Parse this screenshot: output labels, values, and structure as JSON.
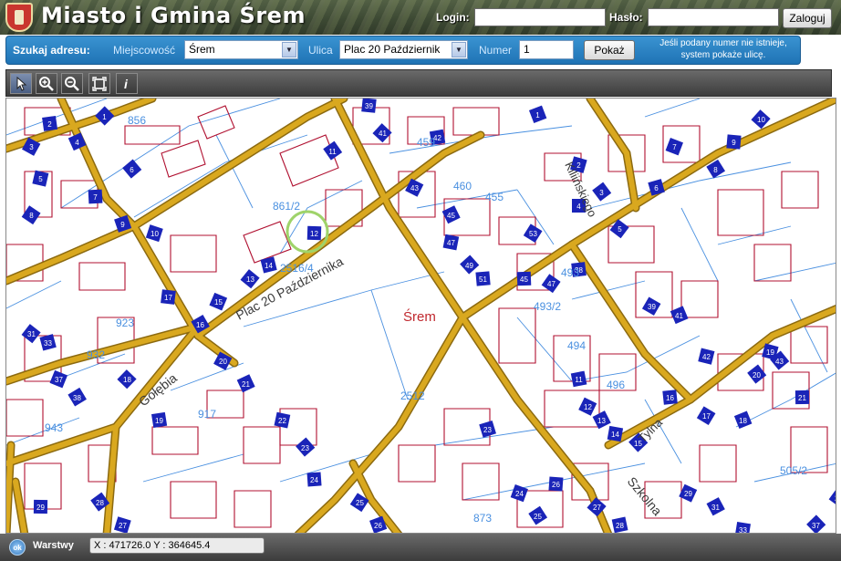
{
  "header": {
    "title": "Miasto i Gmina Śrem",
    "login_label": "Login:",
    "login_value": "",
    "password_label": "Hasło:",
    "password_value": "",
    "login_button": "Zaloguj"
  },
  "search": {
    "label": "Szukaj adresu:",
    "city_label": "Miejscowość",
    "city_value": "Śrem",
    "street_label": "Ulica",
    "street_value": "Plac 20 Październik",
    "number_label": "Numer",
    "number_value": "1",
    "show_button": "Pokaż",
    "hint_line1": "Jeśli podany numer nie istnieje,",
    "hint_line2": "system pokaże ulicę."
  },
  "toolbar": {
    "tools": [
      {
        "name": "pointer-icon",
        "active": true
      },
      {
        "name": "zoom-in-icon",
        "active": false
      },
      {
        "name": "zoom-out-icon",
        "active": false
      },
      {
        "name": "full-extent-icon",
        "active": false
      },
      {
        "name": "info-icon",
        "active": false
      }
    ]
  },
  "map": {
    "colors": {
      "road": "#d9a81f",
      "road_edge": "#8c6a10",
      "parcel": "#4a90e0",
      "building": "#b01030",
      "badge": "#1a24b8"
    },
    "town_label": "Śrem",
    "street_labels": [
      "Plac 20 Października",
      "Gołębia",
      "Szkolna",
      "Tylna",
      "Kiliińskiego"
    ],
    "parcel_labels": [
      "856",
      "861/2",
      "2516/4",
      "923",
      "932",
      "917",
      "943",
      "459",
      "460",
      "455",
      "493/2",
      "493",
      "494",
      "496",
      "2512",
      "505/2",
      "873"
    ],
    "house_numbers": [
      "1",
      "2",
      "3",
      "4",
      "5",
      "6",
      "7",
      "8",
      "9",
      "10",
      "11",
      "12",
      "13",
      "14",
      "15",
      "16",
      "17",
      "18",
      "19",
      "20",
      "21",
      "22",
      "23",
      "24",
      "25",
      "26",
      "27",
      "28",
      "29",
      "31",
      "33",
      "37",
      "38",
      "39",
      "41",
      "42",
      "43",
      "45",
      "47",
      "49",
      "51",
      "53"
    ]
  },
  "status": {
    "layers_label": "Warstwy",
    "ok_icon_label": "ok",
    "coordinates": "X : 471726.0  Y : 364645.4"
  }
}
